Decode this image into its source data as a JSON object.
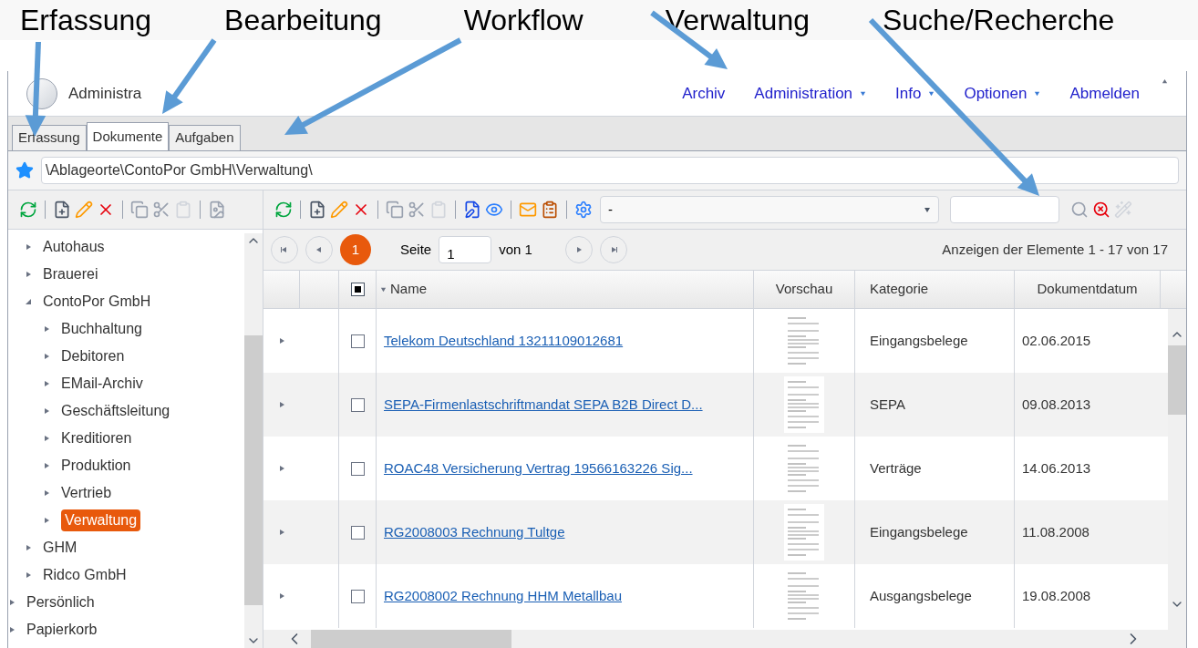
{
  "annotations": [
    "Erfassung",
    "Bearbeitung",
    "Workflow",
    "Verwaltung",
    "Suche/Recherche"
  ],
  "header": {
    "title": "Administra",
    "nav": [
      {
        "label": "Archiv",
        "dropdown": false
      },
      {
        "label": "Administration",
        "dropdown": true
      },
      {
        "label": "Info",
        "dropdown": true
      },
      {
        "label": "Optionen",
        "dropdown": true
      },
      {
        "label": "Abmelden",
        "dropdown": false
      }
    ]
  },
  "tabs": [
    {
      "label": "Erfassung",
      "selected": false
    },
    {
      "label": "Dokumente",
      "selected": true
    },
    {
      "label": "Aufgaben",
      "selected": false
    }
  ],
  "path": "\\Ablageorte\\ContoPor GmbH\\Verwaltung\\",
  "tree": [
    {
      "children": [
        {
          "label": "Autohaus",
          "expanded": false,
          "selected": false
        },
        {
          "label": "Brauerei",
          "expanded": false,
          "selected": false
        },
        {
          "label": "ContoPor GmbH",
          "expanded": true,
          "selected": false,
          "children": [
            {
              "label": "Buchhaltung",
              "expanded": false,
              "selected": false
            },
            {
              "label": "Debitoren",
              "expanded": false,
              "selected": false
            },
            {
              "label": "EMail-Archiv",
              "expanded": false,
              "selected": false
            },
            {
              "label": "Geschäftsleitung",
              "expanded": false,
              "selected": false
            },
            {
              "label": "Kreditioren",
              "expanded": false,
              "selected": false
            },
            {
              "label": "Produktion",
              "expanded": false,
              "selected": false
            },
            {
              "label": "Vertrieb",
              "expanded": false,
              "selected": false
            },
            {
              "label": "Verwaltung",
              "expanded": false,
              "selected": true
            }
          ]
        },
        {
          "label": "GHM",
          "expanded": false,
          "selected": false
        },
        {
          "label": "Ridco GmbH",
          "expanded": false,
          "selected": false
        }
      ]
    },
    {
      "label": "Persönlich",
      "expanded": false,
      "selected": false
    },
    {
      "label": "Papierkorb",
      "expanded": false,
      "selected": false
    }
  ],
  "filter": {
    "value": "-"
  },
  "pager": {
    "current": "1",
    "page_label": "Seite",
    "page_value": "1",
    "of_label": "von 1",
    "summary": "Anzeigen der Elemente 1 - 17 von 17"
  },
  "table": {
    "header_partially_checked": true,
    "columns": [
      "Name",
      "Vorschau",
      "Kategorie",
      "Dokumentdatum"
    ],
    "rows": [
      {
        "name": "Telekom Deutschland 13211109012681",
        "category": "Eingangsbelege",
        "date": "02.06.2015",
        "checked": false
      },
      {
        "name": "SEPA-Firmenlastschriftmandat SEPA B2B Direct D...",
        "category": "SEPA",
        "date": "09.08.2013",
        "checked": false
      },
      {
        "name": "ROAC48 Versicherung Vertrag 19566163226 Sig...",
        "category": "Verträge",
        "date": "14.06.2013",
        "checked": false
      },
      {
        "name": "RG2008003 Rechnung Tultge",
        "category": "Eingangsbelege",
        "date": "11.08.2008",
        "checked": false
      },
      {
        "name": "RG2008002 Rechnung HHM Metallbau",
        "category": "Ausgangsbelege",
        "date": "19.08.2008",
        "checked": false
      }
    ]
  }
}
